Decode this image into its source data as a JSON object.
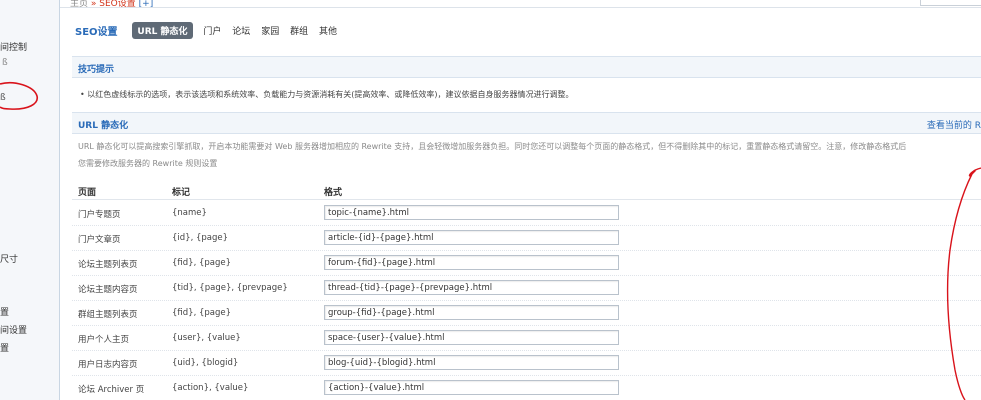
{
  "breadcrumb": {
    "home": "主页",
    "current": "SEO设置",
    "extra": "[+]"
  },
  "sidebar": {
    "items": [
      {
        "label": "间控制"
      },
      {
        "label": "尺寸"
      },
      {
        "label": "置"
      },
      {
        "label": "间设置"
      },
      {
        "label": "置"
      }
    ]
  },
  "tabs": {
    "title": "SEO设置",
    "items": [
      {
        "label": "URL 静态化",
        "active": true
      },
      {
        "label": "门户"
      },
      {
        "label": "论坛"
      },
      {
        "label": "家园"
      },
      {
        "label": "群组"
      },
      {
        "label": "其他"
      }
    ]
  },
  "tips": {
    "title": "技巧提示",
    "text": "• 以红色虚线标示的选项，表示该选项和系统效率、负载能力与资源消耗有关(提高效率、或降低效率)，建议依据自身服务器情况进行调整。"
  },
  "url_section": {
    "title": "URL 静态化",
    "right_link": "查看当前的 R",
    "desc_line1": "URL 静态化可以提高搜索引擎抓取，开启本功能需要对 Web 服务器增加相应的 Rewrite 支持，且会轻微增加服务器负担。同时您还可以调整每个页面的静态格式，但不得删除其中的标记，重置静态格式请留空。注意，修改静态格式后",
    "desc_line2": "您需要修改服务器的 Rewrite 规则设置"
  },
  "table": {
    "headers": {
      "page": "页面",
      "mark": "标记",
      "format": "格式"
    },
    "rows": [
      {
        "page": "门户专题页",
        "mark": "{name}",
        "format": "topic-{name}.html"
      },
      {
        "page": "门户文章页",
        "mark": "{id}, {page}",
        "format": "article-{id}-{page}.html"
      },
      {
        "page": "论坛主题列表页",
        "mark": "{fid}, {page}",
        "format": "forum-{fid}-{page}.html"
      },
      {
        "page": "论坛主题内容页",
        "mark": "{tid}, {page}, {prevpage}",
        "format": "thread-{tid}-{page}-{prevpage}.html"
      },
      {
        "page": "群组主题列表页",
        "mark": "{fid}, {page}",
        "format": "group-{fid}-{page}.html"
      },
      {
        "page": "用户个人主页",
        "mark": "{user}, {value}",
        "format": "space-{user}-{value}.html"
      },
      {
        "page": "用户日志内容页",
        "mark": "{uid}, {blogid}",
        "format": "blog-{uid}-{blogid}.html"
      },
      {
        "page": "论坛 Archiver 页",
        "mark": "{action}, {value}",
        "format": "{action}-{value}.html"
      }
    ]
  },
  "colors": {
    "accent": "#2a6bb8",
    "annotation": "#d9131b",
    "active_tab": "#5f6a76"
  }
}
